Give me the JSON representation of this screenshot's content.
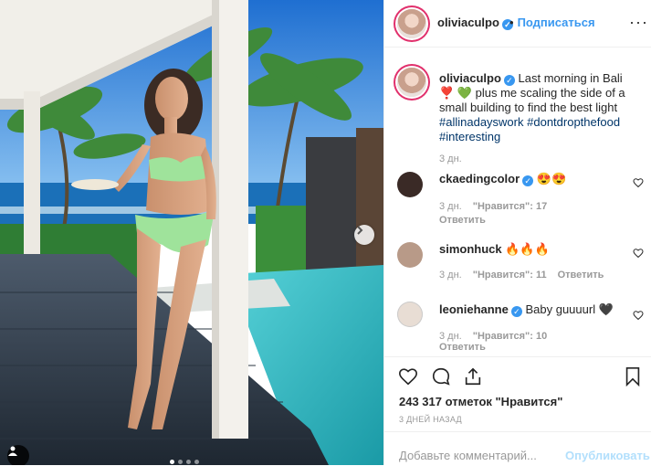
{
  "post": {
    "username": "oliviaculpo",
    "verified_mark": "✓",
    "follow_separator": "•",
    "follow_label": "Подписаться",
    "more_label": "···"
  },
  "caption": {
    "username": "oliviaculpo",
    "text_1": "Last morning in Bali",
    "emoji_1": "❣️",
    "emoji_2": "💚",
    "text_2": "plus me scaling the side of a small building to find the best light",
    "hashtags": [
      "#allinadayswork",
      "#dontdropthefood",
      "#interesting"
    ],
    "time": "3 дн."
  },
  "comments": [
    {
      "username": "ckaedingcolor",
      "text": "😍😍",
      "time": "3 дн.",
      "likes": "\"Нравится\": 17",
      "reply": "Ответить",
      "avatar_color": "#3a2a26"
    },
    {
      "username": "simonhuck",
      "text": "🔥🔥🔥",
      "time": "3 дн.",
      "likes": "\"Нравится\": 11",
      "reply": "Ответить",
      "avatar_color": "#b89a88"
    },
    {
      "username": "leoniehanne",
      "text": "Baby guuuurl 🖤",
      "time": "3 дн.",
      "likes": "\"Нравится\": 10",
      "reply": "Ответить",
      "avatar_color": "#e8ddd4"
    }
  ],
  "actions": {
    "like_icon": "heart-icon",
    "comment_icon": "comment-icon",
    "share_icon": "share-icon",
    "save_icon": "bookmark-icon"
  },
  "likes_text": "243 317 отметок \"Нравится\"",
  "date_text": "3 ДНЕЙ НАЗАД",
  "add_comment": {
    "placeholder": "Добавьте комментарий...",
    "submit_label": "Опубликовать"
  },
  "carousel": {
    "total": 4,
    "active_index": 0
  },
  "colors": {
    "link": "#3897f0",
    "hashtag": "#003569",
    "muted": "#999999",
    "story_ring": "#e1306c"
  }
}
